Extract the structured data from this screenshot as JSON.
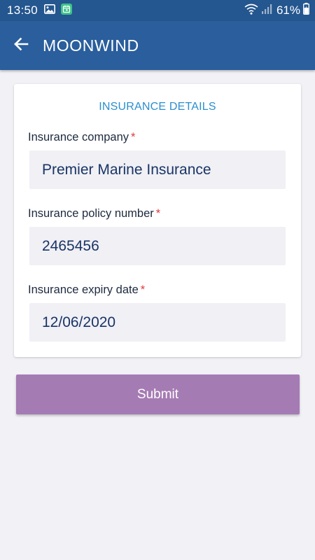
{
  "status_bar": {
    "time": "13:50",
    "battery": "61%",
    "icons": [
      "image-icon",
      "calendar-icon",
      "wifi-icon",
      "signal-icon",
      "battery-icon"
    ]
  },
  "app_bar": {
    "title": "MOONWIND",
    "back_icon": "arrow-left-icon"
  },
  "card": {
    "title": "INSURANCE DETAILS",
    "fields": [
      {
        "label": "Insurance company",
        "required": "*",
        "value": "Premier Marine Insurance"
      },
      {
        "label": "Insurance policy number",
        "required": "*",
        "value": "2465456"
      },
      {
        "label": "Insurance expiry date",
        "required": "*",
        "value": "12/06/2020"
      }
    ]
  },
  "submit": {
    "label": "Submit"
  },
  "colors": {
    "status_bar": "#24568f",
    "app_bar": "#2a5e9c",
    "page_bg": "#f1f1f6",
    "card_title": "#2a8fd0",
    "required": "#e23a3a",
    "input_bg": "#f0f0f5",
    "submit_bg": "#a57bb4"
  }
}
